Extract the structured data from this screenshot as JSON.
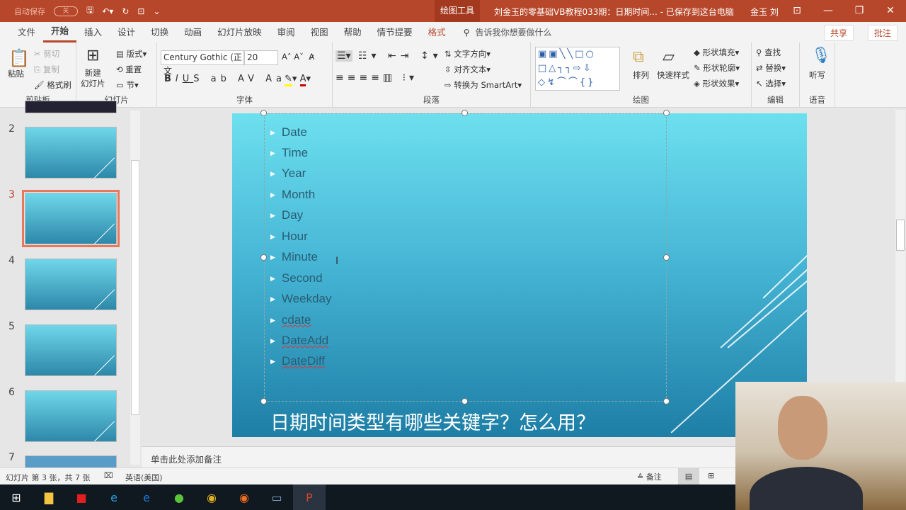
{
  "titlebar": {
    "autosave": "自动保存",
    "autosave_state": "关",
    "tool_tab": "绘图工具",
    "doc_title": "刘金玉的零基础VB教程033期：日期时间...  -  已保存到这台电脑",
    "user": "金玉 刘"
  },
  "menu": {
    "items": [
      "文件",
      "开始",
      "插入",
      "设计",
      "切换",
      "动画",
      "幻灯片放映",
      "审阅",
      "视图",
      "帮助",
      "情节提要",
      "格式"
    ],
    "active": "开始",
    "tellme": "告诉我你想要做什么",
    "share": "共享",
    "comment": "批注"
  },
  "ribbon": {
    "clipboard": {
      "label": "剪贴板",
      "paste": "粘贴",
      "cut": "剪切",
      "copy": "复制",
      "format_painter": "格式刷"
    },
    "slides": {
      "label": "幻灯片",
      "new_slide": "新建\n幻灯片",
      "layout": "版式",
      "reset": "重置",
      "section": "节"
    },
    "font": {
      "label": "字体",
      "font_name": "Century Gothic (正文",
      "font_size": "20"
    },
    "paragraph": {
      "label": "段落",
      "text_direction": "文字方向",
      "align_text": "对齐文本",
      "smartart": "转换为 SmartArt"
    },
    "drawing": {
      "label": "绘图",
      "arrange": "排列",
      "quick_styles": "快速样式",
      "shape_fill": "形状填充",
      "shape_outline": "形状轮廓",
      "shape_effects": "形状效果"
    },
    "editing": {
      "label": "编辑",
      "find": "查找",
      "replace": "替换",
      "select": "选择"
    },
    "voice": {
      "label": "语音",
      "dictate": "听写"
    }
  },
  "thumbnails": [
    {
      "num": "2"
    },
    {
      "num": "3",
      "selected": true
    },
    {
      "num": "4"
    },
    {
      "num": "5"
    },
    {
      "num": "6"
    },
    {
      "num": "7"
    }
  ],
  "slide": {
    "bullets": [
      "Date",
      "Time",
      "Year",
      "Month",
      "Day",
      "Hour",
      "Minute",
      "Second",
      "Weekday",
      "cdate",
      "DateAdd",
      "DateDiff"
    ],
    "title": "日期时间类型有哪些关键字？怎么用？"
  },
  "notes": {
    "placeholder": "单击此处添加备注"
  },
  "status": {
    "slide_info": "幻灯片 第 3 张，共 7 张",
    "language": "英语(美国)",
    "notes": "备注"
  },
  "colors": {
    "accent": "#b7472a",
    "slide_top": "#6de0ef",
    "slide_bottom": "#1e7ea6"
  }
}
